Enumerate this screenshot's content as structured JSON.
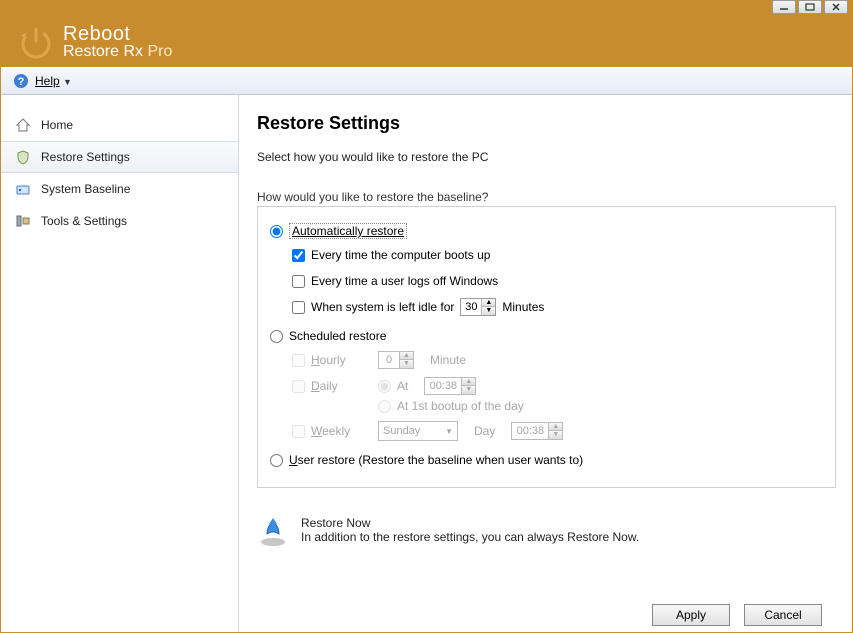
{
  "app": {
    "title_top": "Reboot",
    "title_bottom": "Restore Rx",
    "title_suffix": "Pro"
  },
  "menubar": {
    "help": "Help"
  },
  "sidebar": {
    "items": [
      {
        "label": "Home"
      },
      {
        "label": "Restore Settings"
      },
      {
        "label": "System Baseline"
      },
      {
        "label": "Tools & Settings"
      }
    ]
  },
  "page": {
    "title": "Restore Settings",
    "description": "Select how you would like to restore the PC",
    "question": "How would you like to restore the baseline?",
    "auto": {
      "label": "Automatically restore",
      "bootup": "Every time the computer boots up",
      "logoff": "Every time a user logs off Windows",
      "idle_prefix": "When system is left idle for",
      "idle_value": "30",
      "idle_suffix": "Minutes"
    },
    "scheduled": {
      "label": "Scheduled restore",
      "hourly_label": "Hourly",
      "hourly_value": "0",
      "hourly_unit": "Minute",
      "daily_label": "Daily",
      "at_label": "At",
      "daily_time": "00:38",
      "bootup_label": "At 1st bootup of the day",
      "weekly_label": "Weekly",
      "weekly_day": "Sunday",
      "day_label": "Day",
      "weekly_time": "00:38"
    },
    "user_restore": "User restore (Restore the baseline when user wants to)",
    "restore_now": {
      "title": "Restore Now",
      "subtitle": "In addition to the restore settings, you can always Restore Now."
    },
    "buttons": {
      "apply": "Apply",
      "cancel": "Cancel"
    }
  }
}
